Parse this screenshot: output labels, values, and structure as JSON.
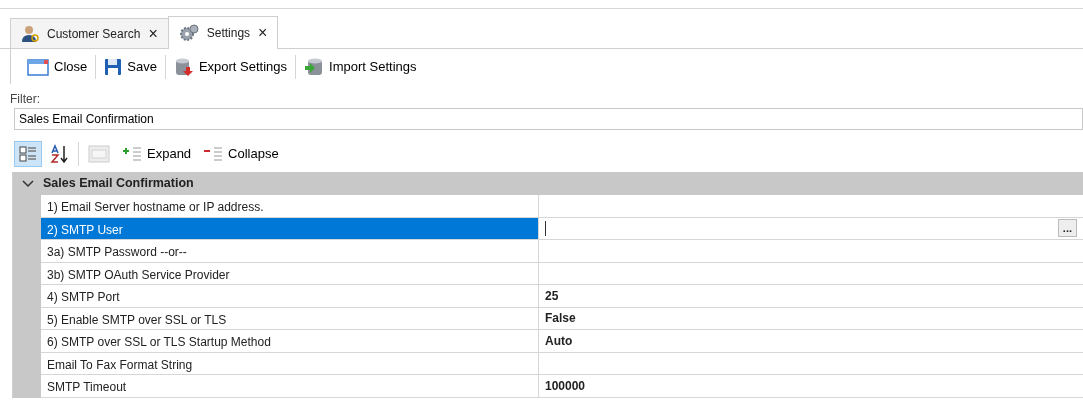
{
  "tabs": [
    {
      "label": "Customer Search",
      "close": "×",
      "selected": false
    },
    {
      "label": "Settings",
      "close": "×",
      "selected": true
    }
  ],
  "toolbar": [
    {
      "label": "Close"
    },
    {
      "label": "Save"
    },
    {
      "label": "Export Settings"
    },
    {
      "label": "Import Settings"
    }
  ],
  "filter": {
    "label": "Filter:",
    "value": "Sales Email Confirmation"
  },
  "grid_toolbar": {
    "categorized_selected": true,
    "alphabetical_selected": false,
    "property_pages_disabled": true,
    "expand": "Expand",
    "collapse": "Collapse"
  },
  "category": {
    "title": "Sales Email Confirmation",
    "expanded": true
  },
  "properties": [
    {
      "name": "1) Email Server hostname or IP address.",
      "selected": false
    },
    {
      "name": "2) SMTP User",
      "selected": true,
      "edit_button": "..."
    },
    {
      "name": "3a) SMTP Password --or--",
      "selected": false
    },
    {
      "name": "3b) SMTP OAuth Service Provider",
      "selected": false
    },
    {
      "name": "4) SMTP Port",
      "value": "25",
      "selected": false
    },
    {
      "name": "5) Enable SMTP over SSL or TLS",
      "value": "False",
      "selected": false
    },
    {
      "name": "6) SMTP over SSL or TLS Startup Method",
      "value": "Auto",
      "selected": false
    },
    {
      "name": "Email To Fax Format String",
      "selected": false
    },
    {
      "name": "SMTP Timeout",
      "value": "100000",
      "selected": false
    }
  ]
}
